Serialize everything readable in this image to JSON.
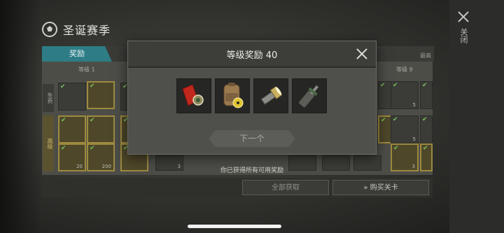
{
  "header": {
    "title": "圣诞赛季",
    "close_label": "关闭"
  },
  "table": {
    "tab_label": "奖励",
    "max_label": "最高",
    "level_labels": [
      "等级 1",
      "等级 9"
    ],
    "row_labels": [
      "免费",
      "高级"
    ],
    "counts": [
      "20",
      "200",
      "3",
      "3",
      "5",
      "5"
    ],
    "received_note": "你已获得所有可用奖励",
    "claim_all_label": "全部获取",
    "buy_pass_label": "购买关卡"
  },
  "modal": {
    "title": "等级奖励 40",
    "next_label": "下一个",
    "rewards": [
      "red-jersey-with-badge",
      "backpack-with-radiation-badge",
      "flashlight",
      "gas-torch"
    ]
  },
  "colors": {
    "accent": "#2e7d86",
    "premium": "#9d8a3e"
  }
}
